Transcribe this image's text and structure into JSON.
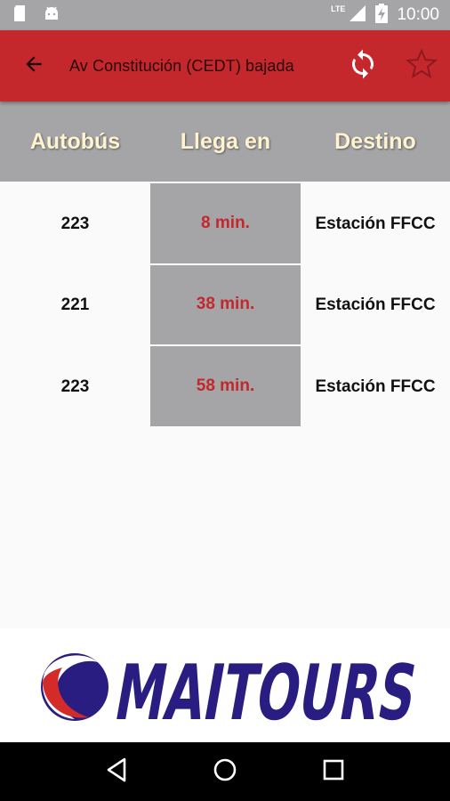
{
  "status_bar": {
    "time": "10:00",
    "network": "LTE",
    "icons": [
      "sd-card-icon",
      "android-icon",
      "signal-icon",
      "battery-charging-icon"
    ]
  },
  "toolbar": {
    "title": "Av Constitución (CEDT) bajada",
    "icons": [
      "back-arrow-icon",
      "refresh-icon",
      "star-outline-icon"
    ]
  },
  "table": {
    "headers": [
      "Autobús",
      "Llega en",
      "Destino"
    ],
    "rows": [
      {
        "bus": "223",
        "eta": "8 min.",
        "destination": "Estación FFCC"
      },
      {
        "bus": "221",
        "eta": "38 min.",
        "destination": "Estación FFCC"
      },
      {
        "bus": "223",
        "eta": "58 min.",
        "destination": "Estación FFCC"
      }
    ]
  },
  "logo": {
    "text": "MAITOURS"
  },
  "nav_bar": {
    "icons": [
      "back-triangle-icon",
      "home-circle-icon",
      "recents-square-icon"
    ]
  },
  "colors": {
    "primary": "#c4272c",
    "header_gray": "#a5a5a7",
    "header_text": "#fff3cf",
    "logo_blue": "#2a1d82",
    "logo_red": "#d32a2a"
  }
}
